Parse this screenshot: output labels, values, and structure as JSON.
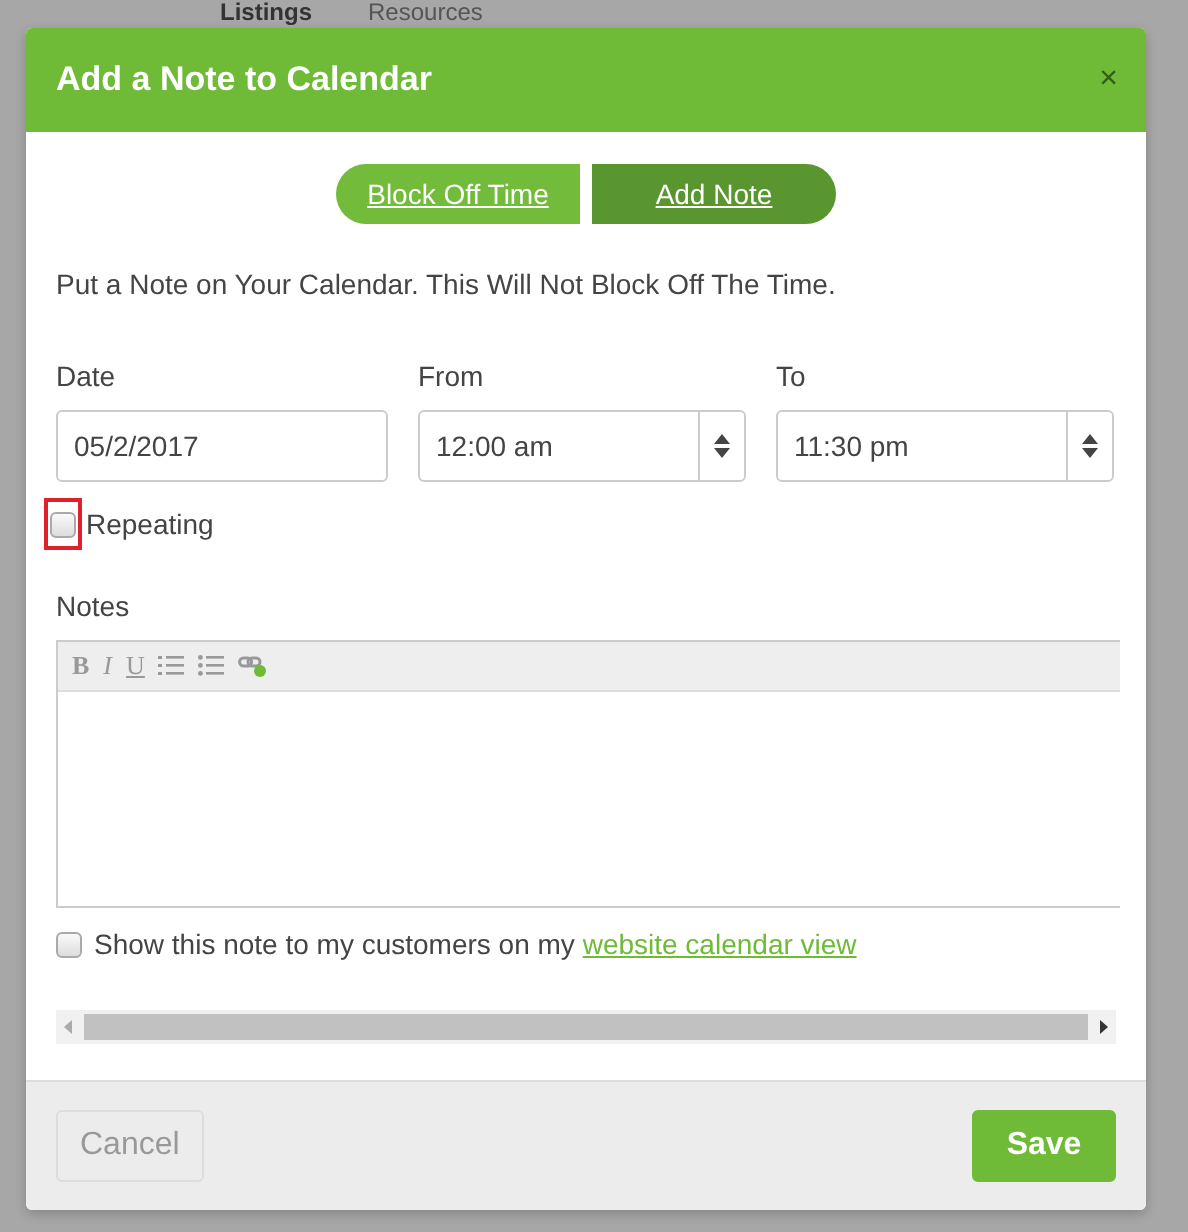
{
  "background_tabs": [
    {
      "label": "Listings",
      "selected": true
    },
    {
      "label": "Resources",
      "selected": false
    }
  ],
  "dialog": {
    "title": "Add a Note to Calendar",
    "close": "×"
  },
  "mode_toggle": [
    {
      "label": "Block Off Time",
      "selected": false
    },
    {
      "label": "Add Note",
      "selected": true
    }
  ],
  "intro": "Put a Note on Your Calendar. This Will Not Block Off The Time.",
  "fields": [
    {
      "label": "Date",
      "value": "05/2/2017",
      "kind": "text"
    },
    {
      "label": "From",
      "value": "12:00 am",
      "kind": "select"
    },
    {
      "label": "To",
      "value": "11:30 pm",
      "kind": "select"
    }
  ],
  "repeating": {
    "label": "Repeating",
    "checked": false,
    "highlighted": true
  },
  "notes": {
    "label": "Notes",
    "toolbar": [
      {
        "kind": "bold",
        "label": "B"
      },
      {
        "kind": "italic",
        "label": "I"
      },
      {
        "kind": "underline",
        "label": "U"
      },
      {
        "kind": "ordered-list"
      },
      {
        "kind": "bullet-list"
      },
      {
        "kind": "link"
      }
    ]
  },
  "share": {
    "text": "Show this note to my customers on my",
    "link": "website calendar view",
    "checked": false
  },
  "buttons": [
    {
      "label": "Cancel",
      "kind": "secondary"
    },
    {
      "label": "Save",
      "kind": "primary"
    }
  ]
}
